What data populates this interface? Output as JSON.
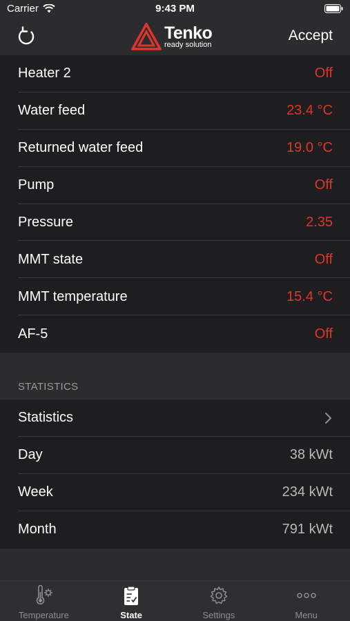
{
  "status_bar": {
    "carrier": "Carrier",
    "time": "9:43 PM"
  },
  "nav": {
    "brand": "Tenko",
    "tagline": "ready solution",
    "accept_label": "Accept"
  },
  "state_rows": [
    {
      "label": "Heater 2",
      "value": "Off"
    },
    {
      "label": "Water feed",
      "value": "23.4  °C"
    },
    {
      "label": "Returned water feed",
      "value": "19.0  °C"
    },
    {
      "label": "Pump",
      "value": "Off"
    },
    {
      "label": "Pressure",
      "value": "2.35"
    },
    {
      "label": "MMT state",
      "value": "Off"
    },
    {
      "label": "MMT temperature",
      "value": "15.4 °C"
    },
    {
      "label": "AF-5",
      "value": "Off"
    }
  ],
  "statistics": {
    "header": "STATISTICS",
    "link_label": "Statistics",
    "rows": [
      {
        "label": "Day",
        "value": "38 kWt"
      },
      {
        "label": "Week",
        "value": "234 kWt"
      },
      {
        "label": "Month",
        "value": "791 kWt"
      }
    ]
  },
  "tabs": [
    {
      "label": "Temperature",
      "icon": "thermometer-icon"
    },
    {
      "label": "State",
      "icon": "clipboard-icon",
      "active": true
    },
    {
      "label": "Settings",
      "icon": "gear-icon"
    },
    {
      "label": "Menu",
      "icon": "more-icon"
    }
  ],
  "colors": {
    "accent_red": "#e0352b",
    "background": "#2c2c2e",
    "row_background": "#1e1e20"
  }
}
